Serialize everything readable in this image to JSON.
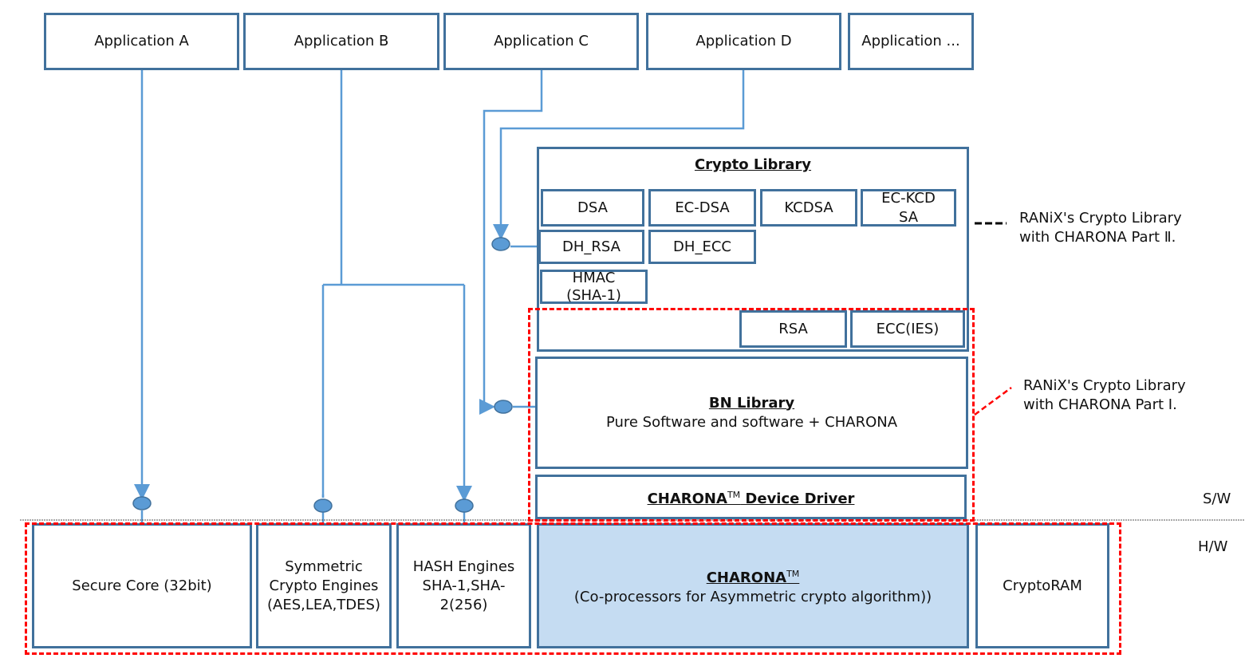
{
  "applications": [
    "Application A",
    "Application B",
    "Application C",
    "Application D",
    "Application ..."
  ],
  "crypto_library": {
    "title": "Crypto Library",
    "modules": [
      "DSA",
      "EC-DSA",
      "KCDSA",
      "EC-KCDSA",
      "DH_RSA",
      "DH_ECC",
      "HMAC (SHA-1)",
      "RSA",
      "ECC(IES)"
    ]
  },
  "bn_library": {
    "title": "BN Library",
    "subtitle": "Pure Software and software + CHARONA"
  },
  "device_driver": {
    "title": "CHARONA",
    "tm": "TM",
    "suffix": " Device Driver"
  },
  "hardware": {
    "secure_core": "Secure Core (32bit)",
    "symmetric": "Symmetric Crypto Engines (AES,LEA,TDES)",
    "hash": "HASH Engines SHA-1,SHA-2(256)",
    "charona_title": "CHARONA",
    "charona_tm": "TM",
    "charona_sub": "(Co-processors for Asymmetric crypto algorithm))",
    "cryptoram": "CryptoRAM"
  },
  "legend": {
    "part2_line1": "RANiX's Crypto Library",
    "part2_line2": "with CHARONA Part Ⅱ.",
    "part1_line1": "RANiX's Crypto Library",
    "part1_line2": "with CHARONA Part Ⅰ."
  },
  "layers": {
    "sw": "S/W",
    "hw": "H/W"
  },
  "colors": {
    "border": "#41719c",
    "connector": "#5b9bd5",
    "highlight": "#c5dcf2",
    "dashed": "#ff0000"
  }
}
